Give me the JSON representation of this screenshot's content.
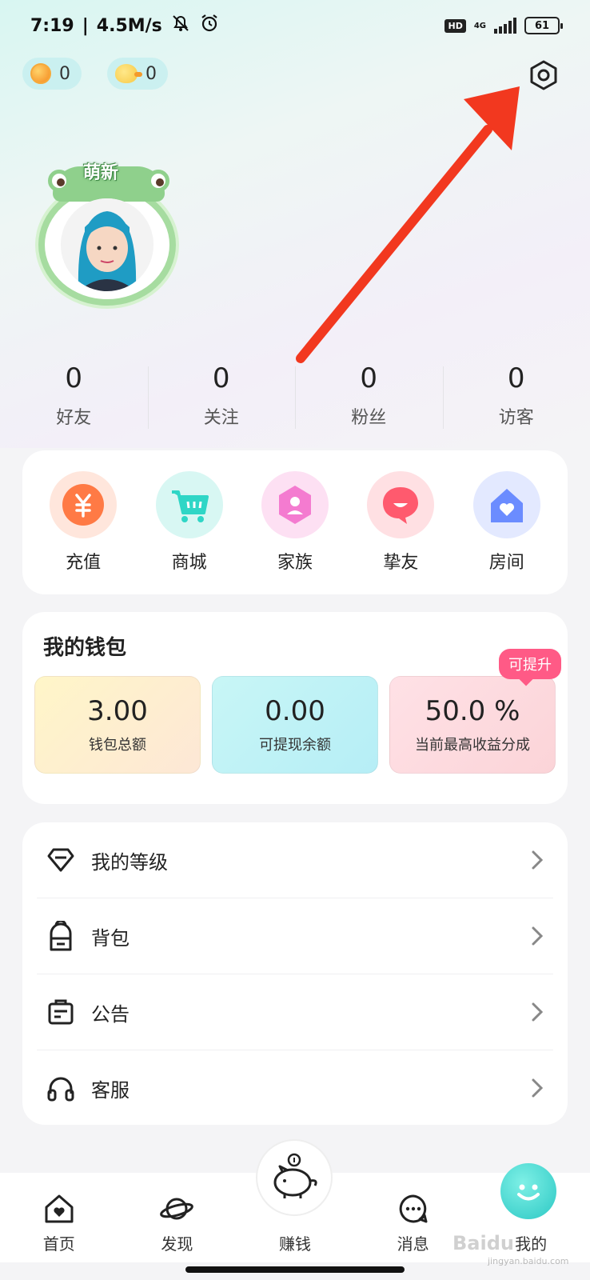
{
  "status_bar": {
    "time": "7:19",
    "separator": "|",
    "speed": "4.5M/s",
    "hd": "HD",
    "network": "4G",
    "battery": "61"
  },
  "header": {
    "coins_count": "0",
    "ducks_count": "0"
  },
  "profile": {
    "frame_label": "萌新"
  },
  "stats": [
    {
      "value": "0",
      "label": "好友"
    },
    {
      "value": "0",
      "label": "关注"
    },
    {
      "value": "0",
      "label": "粉丝"
    },
    {
      "value": "0",
      "label": "访客"
    }
  ],
  "quick_actions": [
    {
      "label": "充值",
      "icon": "yuan-coin-icon",
      "color": "#ff7a45"
    },
    {
      "label": "商城",
      "icon": "shopping-cart-icon",
      "color": "#2fd6c6"
    },
    {
      "label": "家族",
      "icon": "family-shield-icon",
      "color": "#f47bd0"
    },
    {
      "label": "挚友",
      "icon": "chat-heart-icon",
      "color": "#ff5a6e"
    },
    {
      "label": "房间",
      "icon": "house-heart-icon",
      "color": "#6b8cff"
    }
  ],
  "wallet": {
    "title": "我的钱包",
    "upgrade_badge": "可提升",
    "items": [
      {
        "amount": "3.00",
        "label": "钱包总额"
      },
      {
        "amount": "0.00",
        "label": "可提现余额"
      },
      {
        "amount": "50.0 %",
        "label": "当前最高收益分成"
      }
    ]
  },
  "menu": [
    {
      "label": "我的等级",
      "icon": "diamond-icon"
    },
    {
      "label": "背包",
      "icon": "backpack-icon"
    },
    {
      "label": "公告",
      "icon": "notice-bag-icon"
    },
    {
      "label": "客服",
      "icon": "headphones-icon"
    }
  ],
  "tabbar": [
    {
      "label": "首页",
      "icon": "home-icon"
    },
    {
      "label": "发现",
      "icon": "planet-icon"
    },
    {
      "label": "赚钱",
      "icon": "piggy-bank-icon"
    },
    {
      "label": "消息",
      "icon": "message-icon"
    },
    {
      "label": "我的",
      "icon": "smiley-icon"
    }
  ],
  "watermark": {
    "brand": "Baidu",
    "sub": "jingyan.baidu.com"
  },
  "colors": {
    "accent_pink": "#ff5a86",
    "arrow_red": "#f2381f",
    "frog_green": "#8fd08c"
  }
}
